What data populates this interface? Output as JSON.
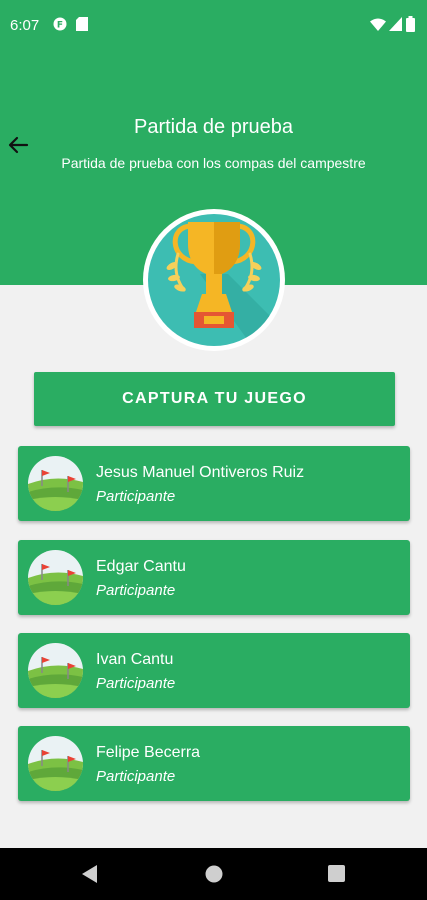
{
  "status_bar": {
    "time": "6:07",
    "icons": [
      "notification-app-icon",
      "sd-card-icon",
      "wifi-icon",
      "signal-icon",
      "battery-icon"
    ]
  },
  "header": {
    "title": "Partida de prueba",
    "subtitle": "Partida de prueba con los compas del campestre",
    "back_icon": "arrow-left-icon",
    "trophy_icon": "trophy-icon"
  },
  "actions": {
    "capture_label": "CAPTURA TU JUEGO"
  },
  "participants": [
    {
      "name": "Jesus Manuel Ontiveros Ruiz",
      "role": "Participante"
    },
    {
      "name": "Edgar Cantu",
      "role": "Participante"
    },
    {
      "name": "Ivan Cantu",
      "role": "Participante"
    },
    {
      "name": "Felipe Becerra",
      "role": "Participante"
    }
  ],
  "nav_bar": {
    "icons": [
      "back-triangle-icon",
      "home-circle-icon",
      "recents-square-icon"
    ]
  },
  "colors": {
    "primary": "#2aad62",
    "background": "#f1f1f1",
    "trophy_bg": "#3dbdb2",
    "trophy_gold": "#f5b625"
  }
}
